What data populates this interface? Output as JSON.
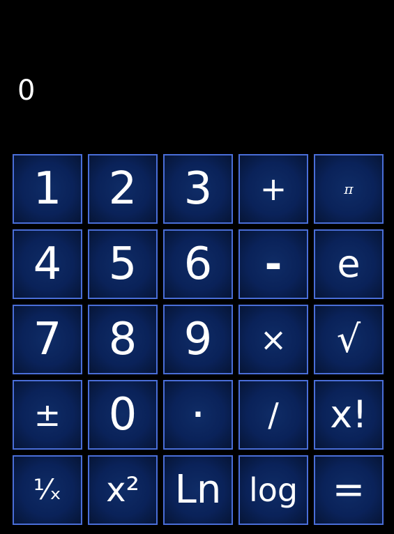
{
  "display": {
    "value": "0"
  },
  "keys": {
    "k1": "1",
    "k2": "2",
    "k3": "3",
    "plus": "+",
    "pi": "π",
    "k4": "4",
    "k5": "5",
    "k6": "6",
    "minus": "-",
    "e": "e",
    "k7": "7",
    "k8": "8",
    "k9": "9",
    "multiply": "×",
    "sqrt": "√",
    "plusminus": "±",
    "k0": "0",
    "dot": "·",
    "divide": "/",
    "factorial": "x!",
    "reciprocal": "¹⁄ₓ",
    "square": "x²",
    "ln": "Ln",
    "log": "log",
    "equals": "="
  },
  "colors": {
    "background": "#000000",
    "key_fill": "#0a2259",
    "key_border": "#4a6ed8",
    "text": "#ffffff"
  }
}
